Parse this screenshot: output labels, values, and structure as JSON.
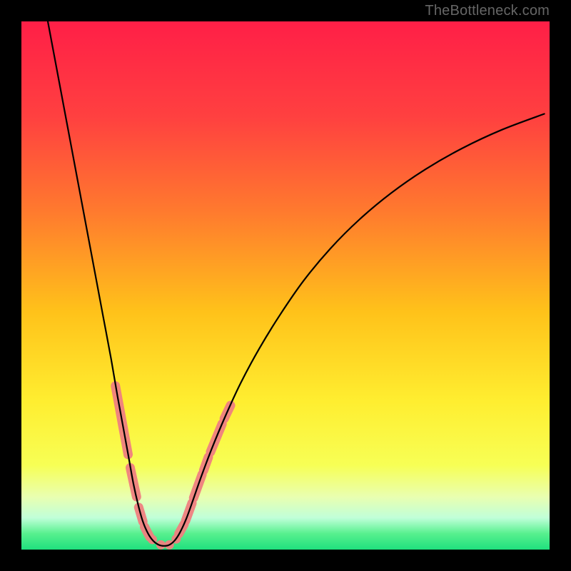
{
  "watermark": "TheBottleneck.com",
  "chart_data": {
    "type": "line",
    "title": "",
    "xlabel": "",
    "ylabel": "",
    "xlim": [
      0,
      100
    ],
    "ylim": [
      0,
      100
    ],
    "background_gradient": {
      "stops": [
        {
          "offset": 0.0,
          "color": "#ff1f47"
        },
        {
          "offset": 0.18,
          "color": "#ff4040"
        },
        {
          "offset": 0.36,
          "color": "#ff7a2e"
        },
        {
          "offset": 0.55,
          "color": "#ffc21a"
        },
        {
          "offset": 0.72,
          "color": "#ffee30"
        },
        {
          "offset": 0.84,
          "color": "#f7ff55"
        },
        {
          "offset": 0.9,
          "color": "#e9ffb0"
        },
        {
          "offset": 0.94,
          "color": "#c0ffd9"
        },
        {
          "offset": 0.97,
          "color": "#57f08e"
        },
        {
          "offset": 1.0,
          "color": "#1fe07e"
        }
      ]
    },
    "series": [
      {
        "name": "bottleneck-curve",
        "color": "#000000",
        "width": 2.2,
        "points": [
          {
            "x": 5.0,
            "y": 100.0
          },
          {
            "x": 6.5,
            "y": 92.0
          },
          {
            "x": 8.0,
            "y": 84.0
          },
          {
            "x": 9.5,
            "y": 76.0
          },
          {
            "x": 11.0,
            "y": 68.0
          },
          {
            "x": 12.5,
            "y": 60.0
          },
          {
            "x": 14.0,
            "y": 52.0
          },
          {
            "x": 15.5,
            "y": 44.0
          },
          {
            "x": 17.0,
            "y": 36.0
          },
          {
            "x": 18.2,
            "y": 29.0
          },
          {
            "x": 19.3,
            "y": 23.0
          },
          {
            "x": 20.3,
            "y": 17.5
          },
          {
            "x": 21.2,
            "y": 12.5
          },
          {
            "x": 22.1,
            "y": 8.5
          },
          {
            "x": 23.0,
            "y": 5.3
          },
          {
            "x": 24.0,
            "y": 3.0
          },
          {
            "x": 25.0,
            "y": 1.6
          },
          {
            "x": 26.0,
            "y": 0.9
          },
          {
            "x": 27.0,
            "y": 0.7
          },
          {
            "x": 28.0,
            "y": 0.9
          },
          {
            "x": 29.0,
            "y": 1.7
          },
          {
            "x": 30.0,
            "y": 3.2
          },
          {
            "x": 31.2,
            "y": 5.8
          },
          {
            "x": 32.5,
            "y": 9.4
          },
          {
            "x": 34.0,
            "y": 13.7
          },
          {
            "x": 36.0,
            "y": 19.0
          },
          {
            "x": 38.5,
            "y": 25.0
          },
          {
            "x": 41.5,
            "y": 31.5
          },
          {
            "x": 45.0,
            "y": 38.0
          },
          {
            "x": 49.0,
            "y": 44.5
          },
          {
            "x": 53.5,
            "y": 51.0
          },
          {
            "x": 58.5,
            "y": 57.0
          },
          {
            "x": 64.0,
            "y": 62.5
          },
          {
            "x": 70.0,
            "y": 67.5
          },
          {
            "x": 76.5,
            "y": 72.0
          },
          {
            "x": 83.5,
            "y": 76.0
          },
          {
            "x": 91.0,
            "y": 79.5
          },
          {
            "x": 99.0,
            "y": 82.5
          }
        ]
      }
    ],
    "highlights": {
      "color": "#f08080",
      "segments_left": [
        {
          "x1": 17.8,
          "y1": 31.0,
          "x2": 20.2,
          "y2": 18.0
        },
        {
          "x1": 20.6,
          "y1": 15.5,
          "x2": 21.8,
          "y2": 10.0
        },
        {
          "x1": 22.2,
          "y1": 8.0,
          "x2": 23.0,
          "y2": 5.3
        },
        {
          "x1": 23.3,
          "y1": 4.3,
          "x2": 24.3,
          "y2": 2.4
        }
      ],
      "segments_right": [
        {
          "x1": 29.8,
          "y1": 3.0,
          "x2": 30.8,
          "y2": 4.8
        },
        {
          "x1": 31.1,
          "y1": 5.5,
          "x2": 32.3,
          "y2": 8.8
        },
        {
          "x1": 32.6,
          "y1": 9.8,
          "x2": 34.2,
          "y2": 14.2
        },
        {
          "x1": 34.5,
          "y1": 15.0,
          "x2": 35.4,
          "y2": 17.5
        },
        {
          "x1": 35.8,
          "y1": 18.5,
          "x2": 38.0,
          "y2": 23.8
        },
        {
          "x1": 38.4,
          "y1": 24.8,
          "x2": 39.6,
          "y2": 27.3
        }
      ],
      "dots_bottom": [
        {
          "x": 24.8,
          "y": 1.9
        },
        {
          "x": 26.4,
          "y": 0.9
        },
        {
          "x": 28.0,
          "y": 0.9
        },
        {
          "x": 29.3,
          "y": 2.0
        }
      ]
    }
  }
}
